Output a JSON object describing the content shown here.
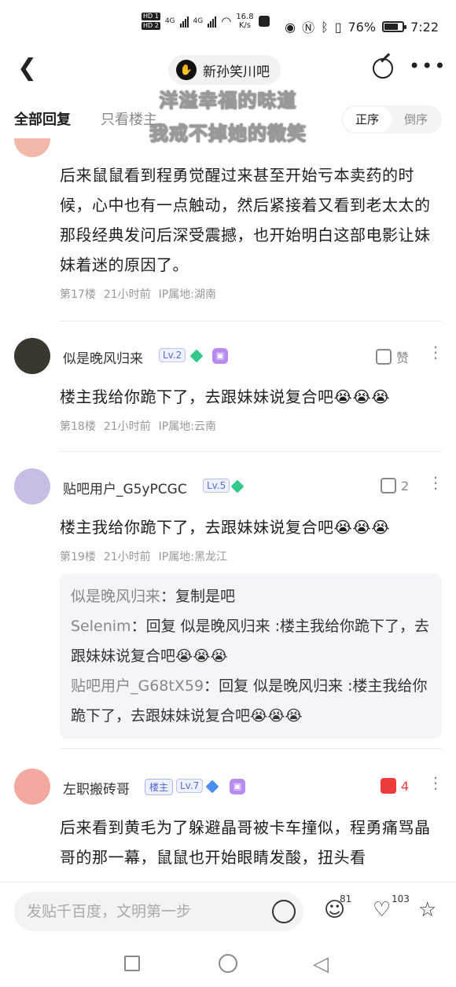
{
  "status": {
    "hd1": "HD 1",
    "hd2": "HD 2",
    "net1": "4G",
    "net2": "4G",
    "speed_value": "16.8",
    "speed_unit": "K/s",
    "battery": "76%",
    "time": "7:22"
  },
  "header": {
    "back_icon": "chevron-left-icon",
    "forum_name": "新孙笑川吧",
    "share_icon": "share-icon",
    "more_icon": "more-icon"
  },
  "subtitles": {
    "line1": "洋溢幸福的味道",
    "line2": "我戒不掉她的微笑"
  },
  "tabs": {
    "all": "全部回复",
    "host_only": "只看楼主",
    "sort_asc": "正序",
    "sort_desc": "倒序"
  },
  "posts": [
    {
      "text": "后来鼠鼠看到程勇觉醒过来甚至开始亏本卖药的时候，心中也有一点触动，然后紧接着又看到老太太的那段经典发问后深受震撼，也开始明白这部电影让妹妹着迷的原因了。",
      "floor": "第17楼",
      "time": "21小时前",
      "ip": "IP属地:湖南"
    },
    {
      "username": "似是晚风归来",
      "level": "Lv.2",
      "like_label": "赞",
      "text": "楼主我给你跪下了，去跟妹妹说复合吧😭😭😭",
      "floor": "第18楼",
      "time": "21小时前",
      "ip": "IP属地:云南"
    },
    {
      "username": "贴吧用户_G5yPCGC",
      "level": "Lv.5",
      "like_count": "2",
      "text": "楼主我给你跪下了，去跟妹妹说复合吧😭😭😭",
      "floor": "第19楼",
      "time": "21小时前",
      "ip": "IP属地:黑龙江",
      "replies": [
        {
          "name": "似是晚风归来",
          "sep": "：",
          "content": "复制是吧"
        },
        {
          "name": "Selenim",
          "sep": "：",
          "content": "回复 似是晚风归来 :楼主我给你跪下了，去跟妹妹说复合吧😭😭😭"
        },
        {
          "name": "贴吧用户_G68tX59",
          "sep": "：",
          "content": "回复 似是晚风归来 :楼主我给你跪下了，去跟妹妹说复合吧😭😭😭"
        }
      ]
    },
    {
      "username": "左职搬砖哥",
      "host_badge": "楼主",
      "level": "Lv.7",
      "like_count": "4",
      "text": "后来看到黄毛为了躲避晶哥被卡车撞似，程勇痛骂晶哥的那一幕，鼠鼠也开始眼睛发酸，扭头看"
    }
  ],
  "bottom": {
    "input_placeholder": "发贴千百度，文明第一步",
    "comment_count": "81",
    "like_count": "103"
  }
}
